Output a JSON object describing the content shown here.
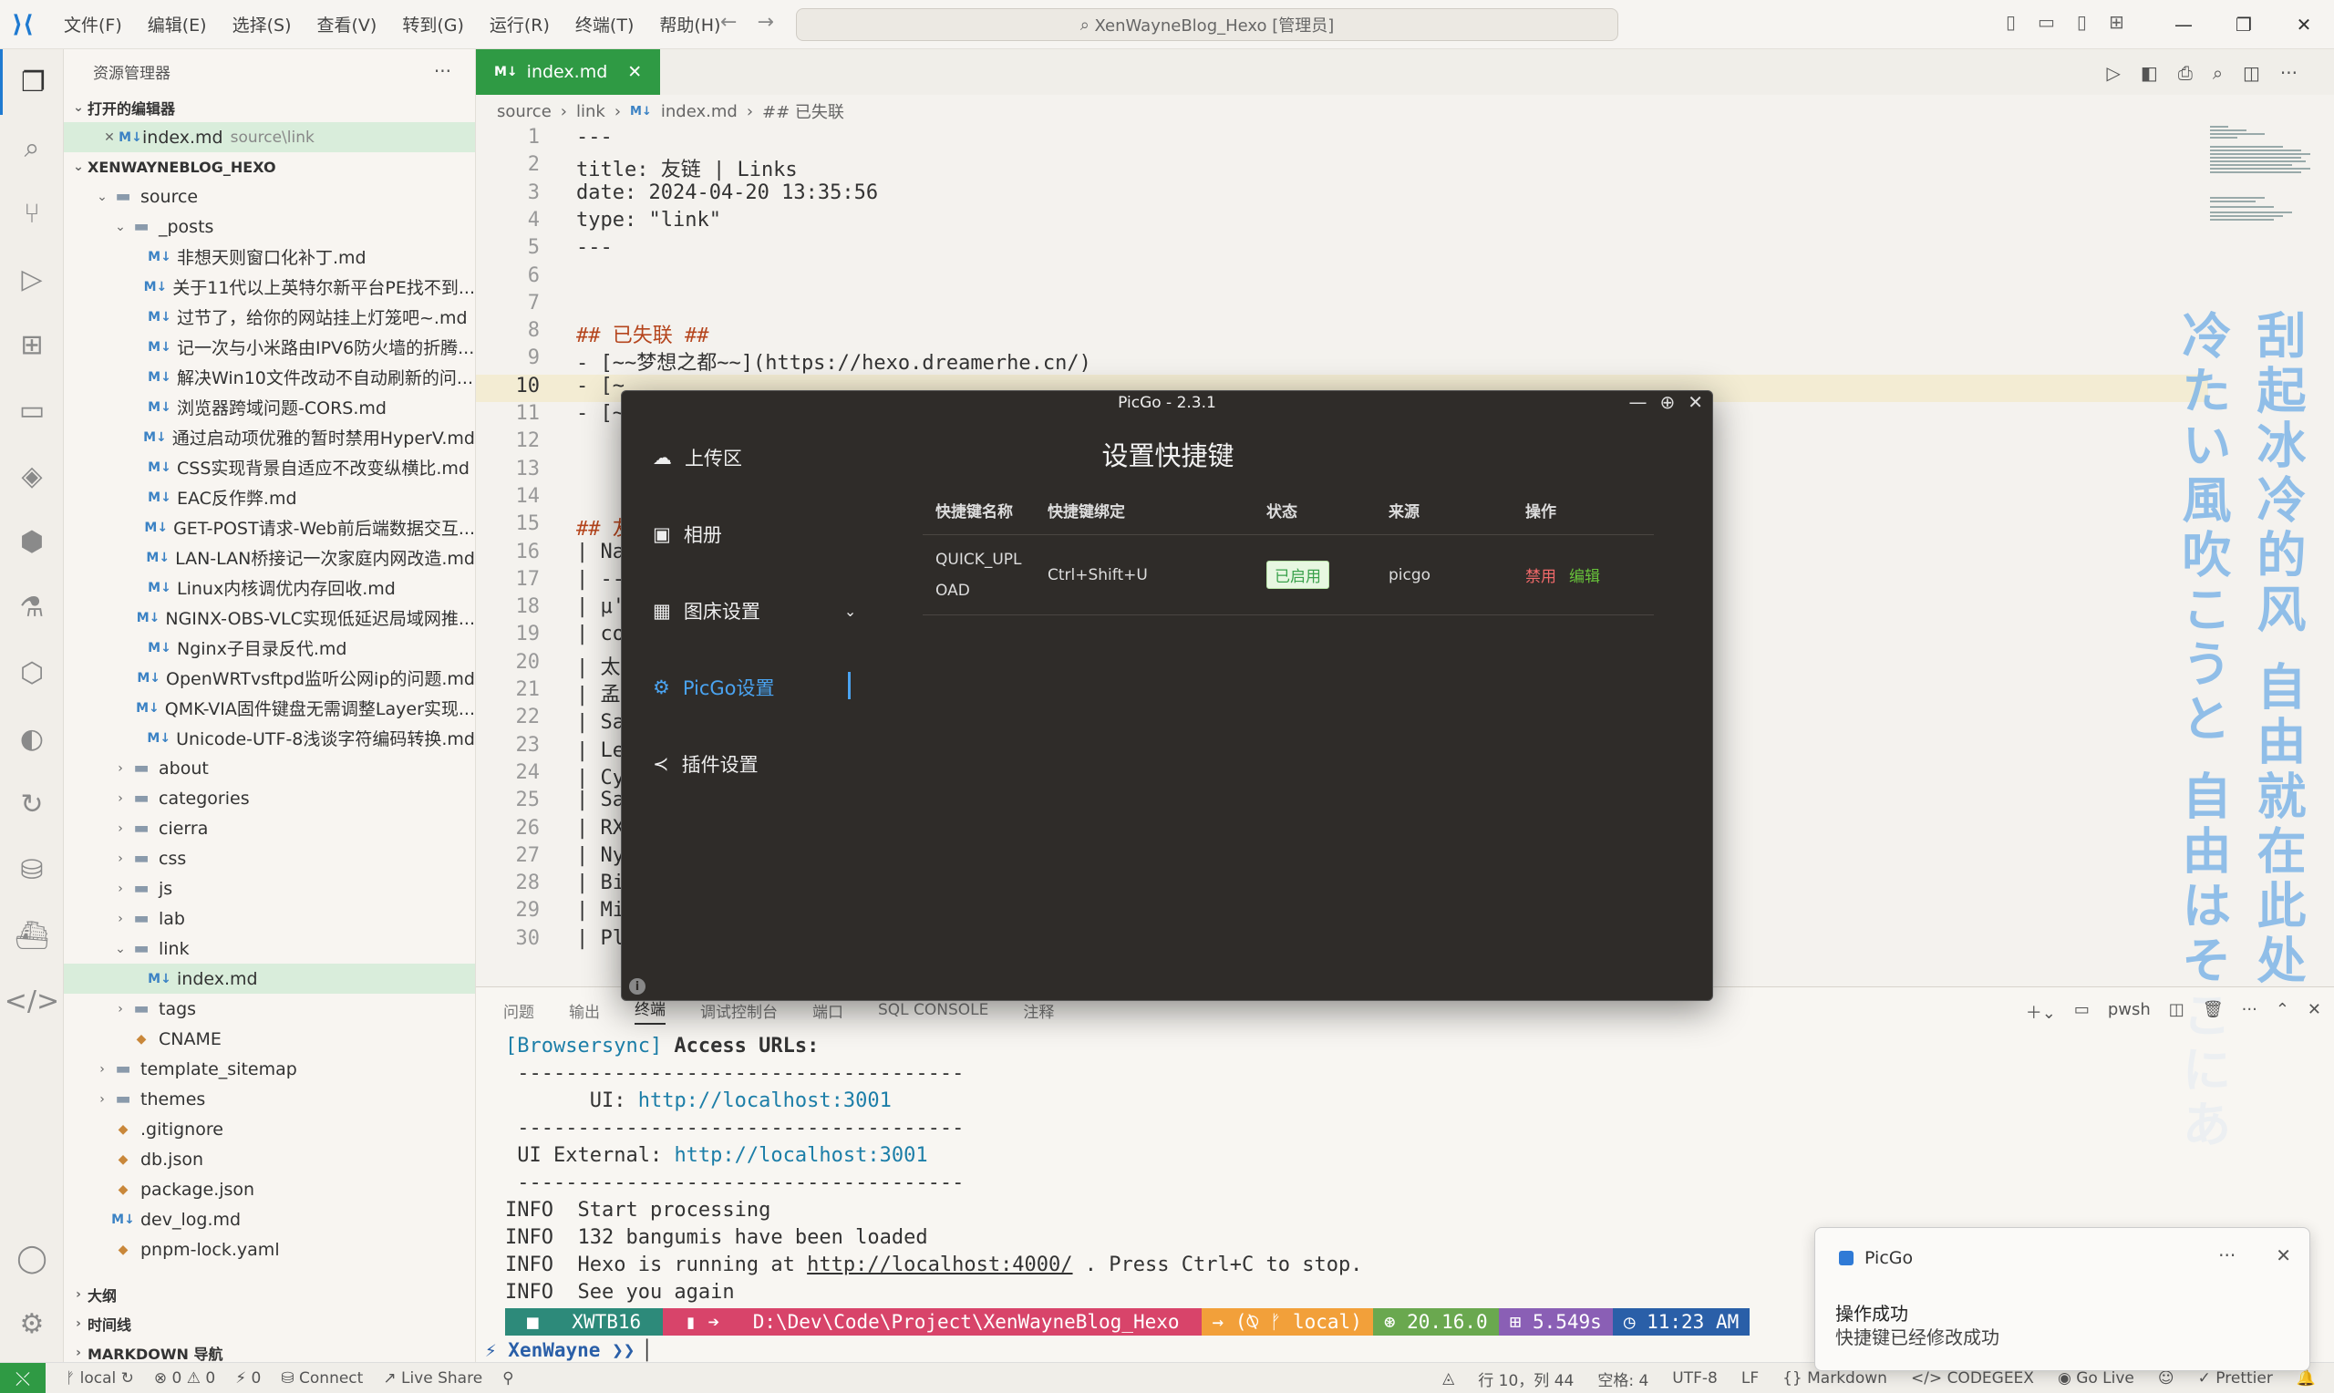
{
  "window": {
    "search": "XenWayneBlog_Hexo [管理员]"
  },
  "menu": [
    "文件(F)",
    "编辑(E)",
    "选择(S)",
    "查看(V)",
    "转到(G)",
    "运行(R)",
    "终端(T)",
    "帮助(H)"
  ],
  "sidebar": {
    "title": "资源管理器",
    "open_editors_label": "打开的编辑器",
    "open_file": "index.md",
    "open_file_path": "source\\link",
    "project_label": "XENWAYNEBLOG_HEXO",
    "tree": [
      {
        "label": "source",
        "depth": 1,
        "type": "folder",
        "open": true
      },
      {
        "label": "_posts",
        "depth": 2,
        "type": "folder",
        "open": true
      },
      {
        "label": "非想天则窗口化补丁.md",
        "depth": 3,
        "type": "md"
      },
      {
        "label": "关于11代以上英特尔新平台PE找不到...",
        "depth": 3,
        "type": "md"
      },
      {
        "label": "过节了，给你的网站挂上灯笼吧~.md",
        "depth": 3,
        "type": "md"
      },
      {
        "label": "记一次与小米路由IPV6防火墙的折腾...",
        "depth": 3,
        "type": "md"
      },
      {
        "label": "解决Win10文件改动不自动刷新的问...",
        "depth": 3,
        "type": "md"
      },
      {
        "label": "浏览器跨域问题-CORS.md",
        "depth": 3,
        "type": "md"
      },
      {
        "label": "通过启动项优雅的暂时禁用HyperV.md",
        "depth": 3,
        "type": "md"
      },
      {
        "label": "CSS实现背景自适应不改变纵横比.md",
        "depth": 3,
        "type": "md"
      },
      {
        "label": "EAC反作弊.md",
        "depth": 3,
        "type": "md"
      },
      {
        "label": "GET-POST请求-Web前后端数据交互...",
        "depth": 3,
        "type": "md"
      },
      {
        "label": "LAN-LAN桥接记一次家庭内网改造.md",
        "depth": 3,
        "type": "md"
      },
      {
        "label": "Linux内核调优内存回收.md",
        "depth": 3,
        "type": "md"
      },
      {
        "label": "NGINX-OBS-VLC实现低延迟局域网推...",
        "depth": 3,
        "type": "md"
      },
      {
        "label": "Nginx子目录反代.md",
        "depth": 3,
        "type": "md"
      },
      {
        "label": "OpenWRTvsftpd监听公网ip的问题.md",
        "depth": 3,
        "type": "md"
      },
      {
        "label": "QMK-VIA固件键盘无需调整Layer实现...",
        "depth": 3,
        "type": "md"
      },
      {
        "label": "Unicode-UTF-8浅谈字符编码转换.md",
        "depth": 3,
        "type": "md"
      },
      {
        "label": "about",
        "depth": 2,
        "type": "folder"
      },
      {
        "label": "categories",
        "depth": 2,
        "type": "folder"
      },
      {
        "label": "cierra",
        "depth": 2,
        "type": "folder"
      },
      {
        "label": "css",
        "depth": 2,
        "type": "folder"
      },
      {
        "label": "js",
        "depth": 2,
        "type": "folder"
      },
      {
        "label": "lab",
        "depth": 2,
        "type": "folder"
      },
      {
        "label": "link",
        "depth": 2,
        "type": "folder",
        "open": true
      },
      {
        "label": "index.md",
        "depth": 3,
        "type": "md",
        "selected": true
      },
      {
        "label": "tags",
        "depth": 2,
        "type": "folder"
      },
      {
        "label": "CNAME",
        "depth": 2,
        "type": "file"
      },
      {
        "label": "template_sitemap",
        "depth": 1,
        "type": "folder"
      },
      {
        "label": "themes",
        "depth": 1,
        "type": "folder"
      },
      {
        "label": ".gitignore",
        "depth": 1,
        "type": "file"
      },
      {
        "label": "db.json",
        "depth": 1,
        "type": "file"
      },
      {
        "label": "package.json",
        "depth": 1,
        "type": "file"
      },
      {
        "label": "dev_log.md",
        "depth": 1,
        "type": "md"
      },
      {
        "label": "pnpm-lock.yaml",
        "depth": 1,
        "type": "file"
      }
    ],
    "outline_label": "大纲",
    "timeline_label": "时间线",
    "markdown_nav_label": "MARKDOWN 导航"
  },
  "editor": {
    "tab": "index.md",
    "breadcrumb": [
      "source",
      "link",
      "index.md",
      "## 已失联"
    ],
    "current_line": 10,
    "lines": [
      "---",
      "title: 友链 | Links",
      "date: 2024-04-20 13:35:56",
      "type: \"link\"",
      "---",
      "",
      "",
      "## 已失联 ##",
      "- [~~梦想之都~~](https://hexo.dreamerhe.cn/)",
      "- [~",
      "- [~",
      "",
      "",
      "",
      "## 友",
      "| Na",
      "| --",
      "| μ'",
      "| co",
      "| 太",
      "| 孟                                                              ) | CSS一键美化 |",
      "| Sa                                                              站 by Akkariin |",
      "| Le                                                              编程语言 |",
      "| Cy                                                              目 |",
      "| Sa",
      "| RX",
      "| Ny",
      "| Bi",
      "| Mi",
      "| Pl"
    ],
    "jp_col1": "刮起冰冷的风 自由就在此处",
    "jp_col2": "冷たい風吹こうと 自由はそこにあ"
  },
  "panel": {
    "tabs": [
      "问题",
      "输出",
      "终端",
      "调试控制台",
      "端口",
      "SQL CONSOLE",
      "注释"
    ],
    "active_tab": "终端",
    "shell": "pwsh",
    "terminal": {
      "l1a": "[Browsersync]",
      "l1b": " Access URLs:",
      "sep": " -------------------------------------",
      "ui_label": "       UI: ",
      "ui_url": "http://localhost:3001",
      "ext_label": " UI External: ",
      "ext_url": "http://localhost:3001",
      "info": "INFO",
      "m1": "  Start processing",
      "m2": "  132 bangumis have been loaded",
      "m3a": "  Hexo is running at ",
      "m3url": "http://localhost:4000/",
      "m3b": " . Press Ctrl+C to stop.",
      "m4": "  See you again"
    },
    "prompt": {
      "host": "XWTB16",
      "path": "D:\\Dev\\Code\\Project\\XenWayneBlog_Hexo",
      "git": "→ (⍉ ᚠ local)",
      "node": "⊛ 20.16.0",
      "time": "⊞ 5.549s",
      "clock": "◷ 11:23 AM",
      "user": "XenWayne",
      "arrow": "❯❯"
    }
  },
  "status": {
    "branch": "local",
    "errors": "⊗ 0 ⚠ 0",
    "ports": "⚡ 0",
    "connect": "Connect",
    "liveshare": "Live Share",
    "cursor": "行 10，列 44",
    "spaces": "空格: 4",
    "encoding": "UTF-8",
    "eol": "LF",
    "lang": "Markdown",
    "codegeex": "CODEGEEX",
    "golive": "Go Live",
    "prettier": "Prettier"
  },
  "picgo": {
    "title": "PicGo - 2.3.1",
    "nav": [
      "上传区",
      "相册",
      "图床设置",
      "PicGo设置",
      "插件设置"
    ],
    "heading": "设置快捷键",
    "columns": [
      "快捷键名称",
      "快捷键绑定",
      "状态",
      "来源",
      "操作"
    ],
    "row": {
      "name_l1": "QUICK_UPL",
      "name_l2": "OAD",
      "binding": "Ctrl+Shift+U",
      "status": "已启用",
      "source": "picgo",
      "disable": "禁用",
      "edit": "编辑"
    }
  },
  "toast": {
    "app": "PicGo",
    "title": "操作成功",
    "body": "快捷键已经修改成功"
  },
  "colors": {
    "accent": "#2f9a44",
    "link": "#1c7ea8",
    "picgo_active": "#4aa3f0"
  }
}
